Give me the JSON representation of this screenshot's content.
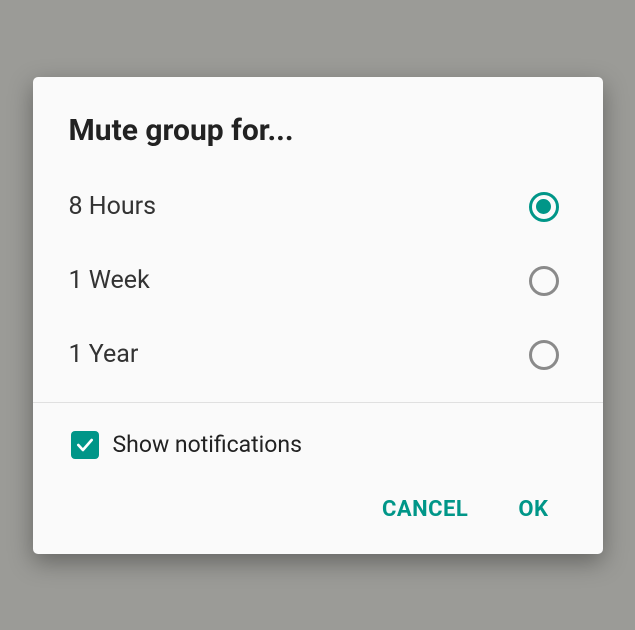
{
  "dialog": {
    "title": "Mute group for...",
    "options": [
      {
        "label": "8 Hours",
        "selected": true
      },
      {
        "label": "1 Week",
        "selected": false
      },
      {
        "label": "1 Year",
        "selected": false
      }
    ],
    "checkbox": {
      "label": "Show notifications",
      "checked": true
    },
    "actions": {
      "cancel": "CANCEL",
      "ok": "OK"
    },
    "colors": {
      "accent": "#009688"
    }
  }
}
